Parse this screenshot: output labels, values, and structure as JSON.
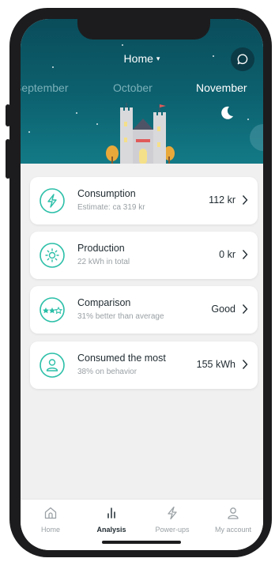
{
  "header": {
    "title": "Home",
    "caret": "▾",
    "chat_icon": "chat-bubble-icon"
  },
  "months": {
    "prev": "September",
    "current": "October",
    "next": "November"
  },
  "cards": [
    {
      "title": "Consumption",
      "subtitle": "Estimate: ca 319 kr",
      "value": "112 kr",
      "icon": "lightning-icon"
    },
    {
      "title": "Production",
      "subtitle": "22 kWh in total",
      "value": "0 kr",
      "icon": "sun-icon"
    },
    {
      "title": "Comparison",
      "subtitle": "31% better than average",
      "value": "Good",
      "icon": "stars-icon"
    },
    {
      "title": "Consumed the most",
      "subtitle": "38% on behavior",
      "value": "155 kWh",
      "icon": "person-icon"
    }
  ],
  "tabs": [
    {
      "label": "Home",
      "icon": "home-icon"
    },
    {
      "label": "Analysis",
      "icon": "bar-chart-icon",
      "active": true
    },
    {
      "label": "Power-ups",
      "icon": "lightning-icon"
    },
    {
      "label": "My account",
      "icon": "person-icon"
    }
  ],
  "colors": {
    "accent": "#2bbfa8",
    "header_dark": "#0a4c5a",
    "header_light": "#137a86",
    "background": "#f0f0f0"
  }
}
